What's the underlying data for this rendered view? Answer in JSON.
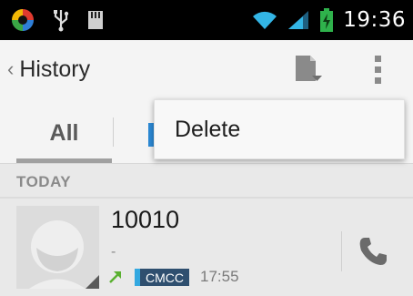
{
  "status_bar": {
    "time": "19:36",
    "icons": [
      "app-notification-icon",
      "usb-icon",
      "sd-card-icon",
      "wifi-icon",
      "signal-icon",
      "battery-charging-icon"
    ],
    "colors": {
      "background": "#000000",
      "wifi": "#33b5e5",
      "battery": "#2fb24c"
    }
  },
  "action_bar": {
    "back_chevron": "‹",
    "title": "History",
    "icons": [
      "save-file-icon",
      "overflow-menu-icon"
    ]
  },
  "tabs": {
    "items": [
      {
        "label": "All",
        "selected": true
      }
    ]
  },
  "popup_menu": {
    "items": [
      {
        "label": "Delete"
      }
    ]
  },
  "section": {
    "label": "TODAY"
  },
  "call_log": {
    "entries": [
      {
        "number": "10010",
        "subtitle": "-",
        "call_type": "outgoing",
        "carrier": "CMCC",
        "time": "17:55"
      }
    ]
  },
  "colors": {
    "accent_blue": "#2c8ad6",
    "outgoing_green": "#5ab030",
    "carrier_badge": "#2f4f6f"
  }
}
